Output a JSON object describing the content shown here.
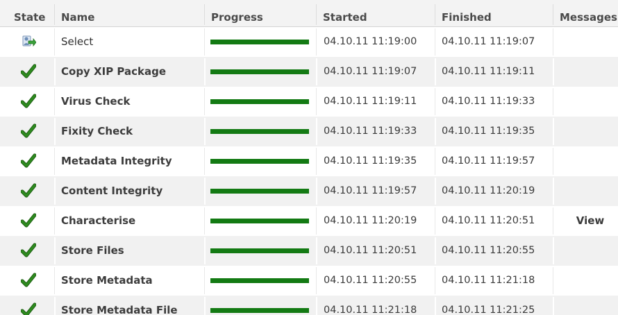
{
  "columns": {
    "state": "State",
    "name": "Name",
    "progress": "Progress",
    "started": "Started",
    "finished": "Finished",
    "messages": "Messages"
  },
  "colors": {
    "progress_fill": "#137a13",
    "check": "#2e8b1f",
    "header_bg": "#f3f3f3"
  },
  "rows": [
    {
      "state_icon": "running-workflow-icon",
      "name": "Select",
      "progress": 1.0,
      "started": "04.10.11 11:19:00",
      "finished": "04.10.11 11:19:07",
      "message": ""
    },
    {
      "state_icon": "check-icon",
      "name": "Copy XIP Package",
      "progress": 1.0,
      "started": "04.10.11 11:19:07",
      "finished": "04.10.11 11:19:11",
      "message": ""
    },
    {
      "state_icon": "check-icon",
      "name": "Virus Check",
      "progress": 1.0,
      "started": "04.10.11 11:19:11",
      "finished": "04.10.11 11:19:33",
      "message": ""
    },
    {
      "state_icon": "check-icon",
      "name": "Fixity Check",
      "progress": 1.0,
      "started": "04.10.11 11:19:33",
      "finished": "04.10.11 11:19:35",
      "message": ""
    },
    {
      "state_icon": "check-icon",
      "name": "Metadata Integrity",
      "progress": 1.0,
      "started": "04.10.11 11:19:35",
      "finished": "04.10.11 11:19:57",
      "message": ""
    },
    {
      "state_icon": "check-icon",
      "name": "Content Integrity",
      "progress": 1.0,
      "started": "04.10.11 11:19:57",
      "finished": "04.10.11 11:20:19",
      "message": ""
    },
    {
      "state_icon": "check-icon",
      "name": "Characterise",
      "progress": 1.0,
      "started": "04.10.11 11:20:19",
      "finished": "04.10.11 11:20:51",
      "message": "View"
    },
    {
      "state_icon": "check-icon",
      "name": "Store Files",
      "progress": 1.0,
      "started": "04.10.11 11:20:51",
      "finished": "04.10.11 11:20:55",
      "message": ""
    },
    {
      "state_icon": "check-icon",
      "name": "Store Metadata",
      "progress": 1.0,
      "started": "04.10.11 11:20:55",
      "finished": "04.10.11 11:21:18",
      "message": ""
    },
    {
      "state_icon": "check-icon",
      "name": "Store Metadata File",
      "progress": 1.0,
      "started": "04.10.11 11:21:18",
      "finished": "04.10.11 11:21:25",
      "message": ""
    }
  ]
}
